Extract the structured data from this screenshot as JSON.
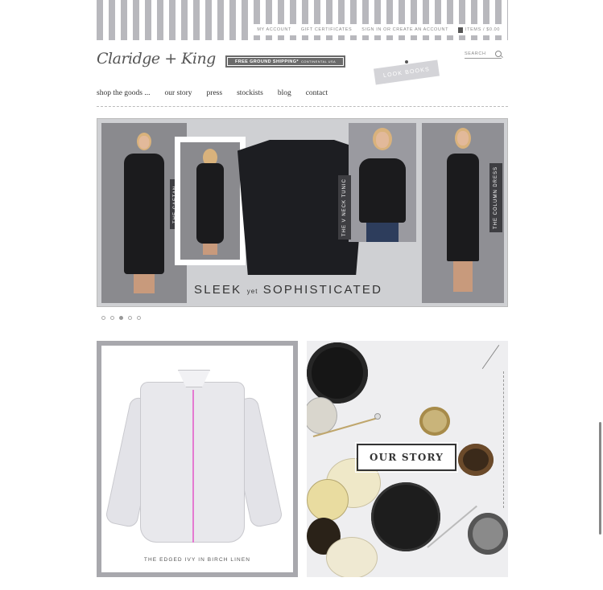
{
  "header": {
    "top_links": [
      "MY ACCOUNT",
      "GIFT CERTIFICATES",
      "SIGN IN OR CREATE AN ACCOUNT"
    ],
    "cart": "ITEMS / $0.00",
    "logo": "Claridge + King",
    "shipping_banner": "FREE GROUND SHIPPING*",
    "shipping_sub": "CONTINENTAL USA",
    "lookbooks": "LOOK BOOKS",
    "search_placeholder": "SEARCH"
  },
  "nav": {
    "items": [
      "shop the goods ...",
      "our story",
      "press",
      "stockists",
      "blog",
      "contact"
    ]
  },
  "hero": {
    "tags": [
      "THE CAFTAN",
      "THE V NECK TUNIC",
      "THE COLUMN DRESS"
    ],
    "title_left": "SLEEK",
    "title_mid": "yet",
    "title_right": "SOPHISTICATED"
  },
  "carousel": {
    "slides": 5,
    "active": 3
  },
  "tiles": {
    "left_caption": "THE EDGED IVY IN BIRCH LINEN",
    "right_label": "OUR STORY"
  },
  "colors": {
    "stripe": "#b8b8bd",
    "accent_placket": "#e47ad1",
    "tag_bg": "#3e3e42"
  }
}
